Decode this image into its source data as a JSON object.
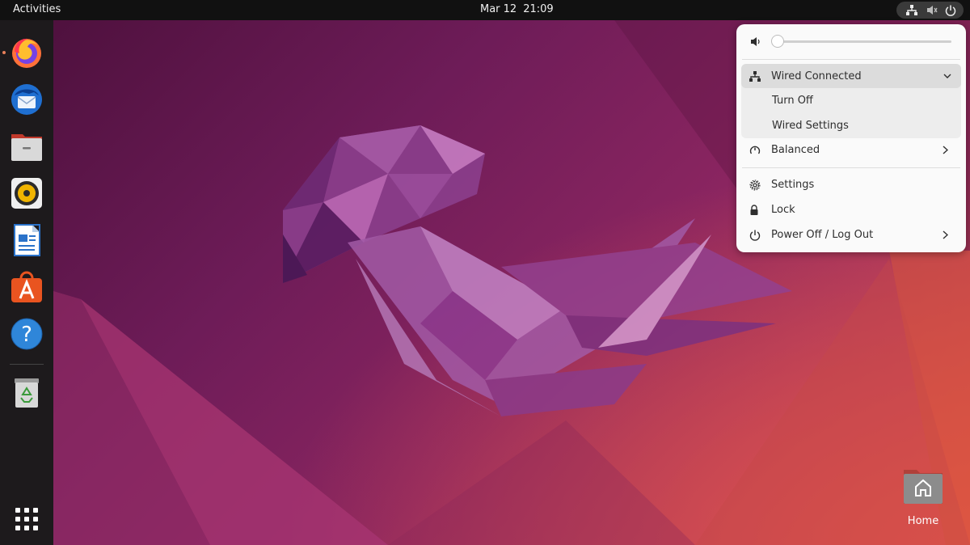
{
  "topbar": {
    "activities": "Activities",
    "date": "Mar 12",
    "time": "21:09",
    "status_icons": [
      "network-wired-icon",
      "volume-muted-icon",
      "power-icon"
    ]
  },
  "dock": {
    "apps": [
      {
        "name": "Firefox",
        "icon": "firefox-icon",
        "running": true
      },
      {
        "name": "Thunderbird Mail",
        "icon": "thunderbird-icon",
        "running": false
      },
      {
        "name": "Files",
        "icon": "files-icon",
        "running": false
      },
      {
        "name": "Rhythmbox",
        "icon": "rhythmbox-icon",
        "running": false
      },
      {
        "name": "LibreOffice Writer",
        "icon": "writer-icon",
        "running": false
      },
      {
        "name": "Ubuntu Software",
        "icon": "software-icon",
        "running": false
      },
      {
        "name": "Help",
        "icon": "help-icon",
        "running": false
      },
      {
        "name": "Trash",
        "icon": "trash-icon",
        "running": false
      }
    ],
    "show_apps_icon": "app-grid-icon"
  },
  "desktop": {
    "home_label": "Home"
  },
  "system_menu": {
    "volume": {
      "level": 0.0,
      "icon": "volume-icon"
    },
    "network": {
      "label": "Wired Connected",
      "expanded": true,
      "items": [
        "Turn Off",
        "Wired Settings"
      ]
    },
    "power_mode": {
      "label": "Balanced"
    },
    "settings_label": "Settings",
    "lock_label": "Lock",
    "power_label": "Power Off / Log Out"
  },
  "colors": {
    "topbar": "#111111",
    "dock": "#1d1a1c",
    "menu_bg": "#fafafa",
    "accent": "#e95420"
  }
}
